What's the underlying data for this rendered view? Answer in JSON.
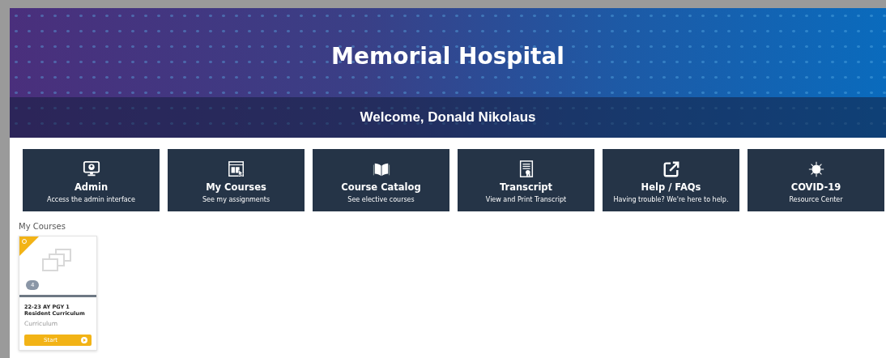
{
  "header": {
    "title": "Memorial Hospital",
    "welcome": "Welcome, Donald Nikolaus"
  },
  "tiles": [
    {
      "title": "Admin",
      "subtitle": "Access the admin interface"
    },
    {
      "title": "My Courses",
      "subtitle": "See my assignments"
    },
    {
      "title": "Course Catalog",
      "subtitle": "See elective courses"
    },
    {
      "title": "Transcript",
      "subtitle": "View and Print Transcript"
    },
    {
      "title": "Help / FAQs",
      "subtitle": "Having trouble? We're here to help."
    },
    {
      "title": "COVID-19",
      "subtitle": "Resource Center"
    }
  ],
  "section_title": "My Courses",
  "courses": [
    {
      "count": "4",
      "title": "22-23 AY PGY 1 Resident Curriculum",
      "type": "Curriculum",
      "button": "Start"
    }
  ]
}
